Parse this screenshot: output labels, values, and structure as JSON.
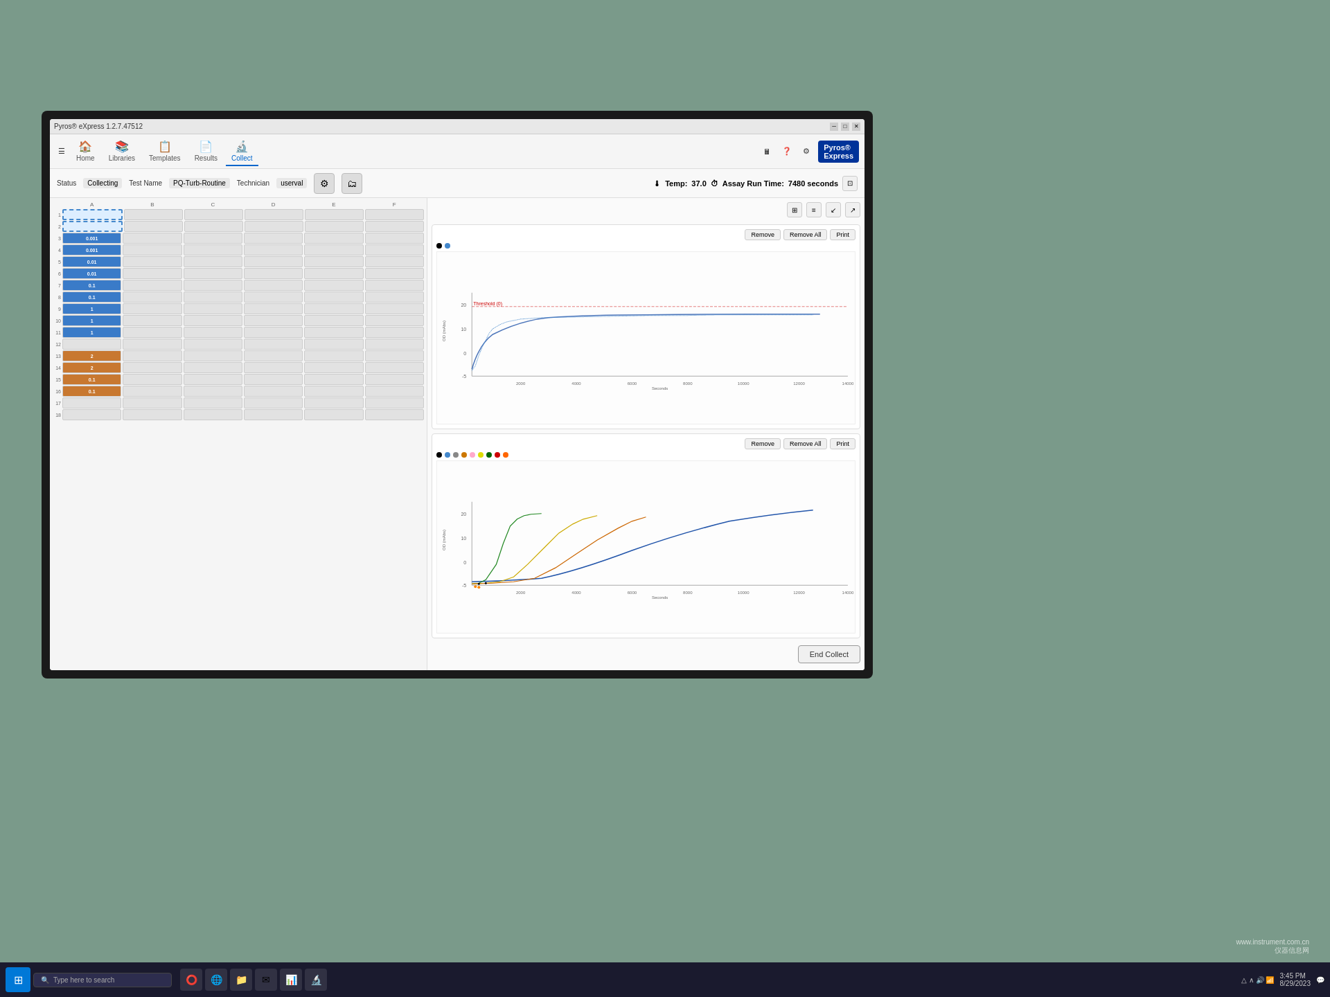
{
  "app": {
    "title": "Pyros® eXpress 1.2.7.47512",
    "version": "1.2.7.47512"
  },
  "nav": {
    "items": [
      {
        "id": "home",
        "label": "Home",
        "icon": "🏠",
        "active": false
      },
      {
        "id": "libraries",
        "label": "Libraries",
        "icon": "📚",
        "active": false
      },
      {
        "id": "templates",
        "label": "Templates",
        "icon": "📋",
        "active": false
      },
      {
        "id": "results",
        "label": "Results",
        "icon": "📄",
        "active": false
      },
      {
        "id": "collect",
        "label": "Collect",
        "icon": "🔬",
        "active": true
      }
    ],
    "logo_text": "Pyros\nExpress"
  },
  "status_bar": {
    "status_label": "Status",
    "status_value": "Collecting",
    "test_name_label": "Test Name",
    "test_name_value": "PQ-Turb-Routine",
    "technician_label": "Technician",
    "technician_value": "userval",
    "temp_label": "Temp:",
    "temp_value": "37.0",
    "assay_run_label": "Assay Run Time:",
    "assay_run_value": "7480 seconds"
  },
  "chart_top": {
    "legend": [
      {
        "color": "#000000",
        "label": ""
      },
      {
        "color": "#4488cc",
        "label": ""
      }
    ],
    "buttons": [
      "Remove",
      "Remove All",
      "Print"
    ],
    "icons": [
      "⊞",
      "≡",
      "↙",
      "↗"
    ],
    "threshold_label": "Threshold (0)",
    "x_label": "Seconds",
    "y_label": "OD (mAbs)",
    "x_ticks": [
      "2000",
      "4000",
      "6000",
      "8000",
      "10000",
      "12000",
      "14000"
    ],
    "y_ticks": [
      "-5",
      "0",
      "10",
      "20"
    ]
  },
  "chart_bottom": {
    "legend": [
      {
        "color": "#000000"
      },
      {
        "color": "#4488cc"
      },
      {
        "color": "#888888"
      },
      {
        "color": "#cc7700"
      },
      {
        "color": "#ffaacc"
      },
      {
        "color": "#ffff00"
      },
      {
        "color": "#008800"
      },
      {
        "color": "#cc0000"
      },
      {
        "color": "#ff6600"
      }
    ],
    "buttons": [
      "Remove",
      "Remove All",
      "Print"
    ],
    "x_label": "Seconds",
    "y_label": "OD (mAbs)",
    "x_ticks": [
      "2000",
      "4000",
      "6000",
      "8000",
      "10000",
      "12000",
      "14000"
    ],
    "y_ticks": [
      "-5",
      "0",
      "10",
      "20"
    ]
  },
  "end_collect_btn": "End Collect",
  "samples": {
    "rows": [
      {
        "num": 1,
        "cells": [
          {
            "type": "sel"
          },
          {
            "type": "empty"
          },
          {
            "type": "empty"
          },
          {
            "type": "empty"
          },
          {
            "type": "empty"
          },
          {
            "type": "empty"
          }
        ]
      },
      {
        "num": 2,
        "cells": [
          {
            "type": "sel"
          },
          {
            "type": "empty"
          },
          {
            "type": "empty"
          },
          {
            "type": "empty"
          },
          {
            "type": "empty"
          },
          {
            "type": "empty"
          }
        ]
      },
      {
        "num": 3,
        "cells": [
          {
            "type": "blue",
            "label": "0.001"
          },
          {
            "type": "empty"
          },
          {
            "type": "empty"
          },
          {
            "type": "empty"
          },
          {
            "type": "empty"
          },
          {
            "type": "empty"
          }
        ]
      },
      {
        "num": 4,
        "cells": [
          {
            "type": "blue",
            "label": "0.001"
          },
          {
            "type": "empty"
          },
          {
            "type": "empty"
          },
          {
            "type": "empty"
          },
          {
            "type": "empty"
          },
          {
            "type": "empty"
          }
        ]
      },
      {
        "num": 5,
        "cells": [
          {
            "type": "blue",
            "label": "0.01"
          },
          {
            "type": "empty"
          },
          {
            "type": "empty"
          },
          {
            "type": "empty"
          },
          {
            "type": "empty"
          },
          {
            "type": "empty"
          }
        ]
      },
      {
        "num": 6,
        "cells": [
          {
            "type": "blue",
            "label": "0.01"
          },
          {
            "type": "empty"
          },
          {
            "type": "empty"
          },
          {
            "type": "empty"
          },
          {
            "type": "empty"
          },
          {
            "type": "empty"
          }
        ]
      },
      {
        "num": 7,
        "cells": [
          {
            "type": "blue",
            "label": "0.1"
          },
          {
            "type": "empty"
          },
          {
            "type": "empty"
          },
          {
            "type": "empty"
          },
          {
            "type": "empty"
          },
          {
            "type": "empty"
          }
        ]
      },
      {
        "num": 8,
        "cells": [
          {
            "type": "blue",
            "label": "0.1"
          },
          {
            "type": "empty"
          },
          {
            "type": "empty"
          },
          {
            "type": "empty"
          },
          {
            "type": "empty"
          },
          {
            "type": "empty"
          }
        ]
      },
      {
        "num": 9,
        "cells": [
          {
            "type": "blue",
            "label": "1"
          },
          {
            "type": "empty"
          },
          {
            "type": "empty"
          },
          {
            "type": "empty"
          },
          {
            "type": "empty"
          },
          {
            "type": "empty"
          }
        ]
      },
      {
        "num": 10,
        "cells": [
          {
            "type": "blue",
            "label": "1"
          },
          {
            "type": "empty"
          },
          {
            "type": "empty"
          },
          {
            "type": "empty"
          },
          {
            "type": "empty"
          },
          {
            "type": "empty"
          }
        ]
      },
      {
        "num": 11,
        "cells": [
          {
            "type": "blue",
            "label": "1"
          },
          {
            "type": "empty"
          },
          {
            "type": "empty"
          },
          {
            "type": "empty"
          },
          {
            "type": "empty"
          },
          {
            "type": "empty"
          }
        ]
      },
      {
        "num": 12,
        "cells": [
          {
            "type": "empty"
          },
          {
            "type": "empty"
          },
          {
            "type": "empty"
          },
          {
            "type": "empty"
          },
          {
            "type": "empty"
          },
          {
            "type": "empty"
          }
        ]
      },
      {
        "num": 13,
        "cells": [
          {
            "type": "orange",
            "label": "2"
          },
          {
            "type": "empty"
          },
          {
            "type": "empty"
          },
          {
            "type": "empty"
          },
          {
            "type": "empty"
          },
          {
            "type": "empty"
          }
        ]
      },
      {
        "num": 14,
        "cells": [
          {
            "type": "orange",
            "label": "2"
          },
          {
            "type": "empty"
          },
          {
            "type": "empty"
          },
          {
            "type": "empty"
          },
          {
            "type": "empty"
          },
          {
            "type": "empty"
          }
        ]
      },
      {
        "num": 15,
        "cells": [
          {
            "type": "orange",
            "label": "0.1"
          },
          {
            "type": "empty"
          },
          {
            "type": "empty"
          },
          {
            "type": "empty"
          },
          {
            "type": "empty"
          },
          {
            "type": "empty"
          }
        ]
      },
      {
        "num": 16,
        "cells": [
          {
            "type": "orange",
            "label": "0.1"
          },
          {
            "type": "empty"
          },
          {
            "type": "empty"
          },
          {
            "type": "empty"
          },
          {
            "type": "empty"
          },
          {
            "type": "empty"
          }
        ]
      },
      {
        "num": 17,
        "cells": [
          {
            "type": "empty"
          },
          {
            "type": "empty"
          },
          {
            "type": "empty"
          },
          {
            "type": "empty"
          },
          {
            "type": "empty"
          },
          {
            "type": "empty"
          }
        ]
      },
      {
        "num": 18,
        "cells": [
          {
            "type": "empty"
          },
          {
            "type": "empty"
          },
          {
            "type": "empty"
          },
          {
            "type": "empty"
          },
          {
            "type": "empty"
          },
          {
            "type": "empty"
          }
        ]
      }
    ]
  },
  "taskbar": {
    "search_placeholder": "Type here to search",
    "time": "3:45 PM",
    "date": "8/29/2023"
  },
  "watermark": {
    "line1": "www.instrument.com.cn",
    "logo": "仪器信息网"
  }
}
